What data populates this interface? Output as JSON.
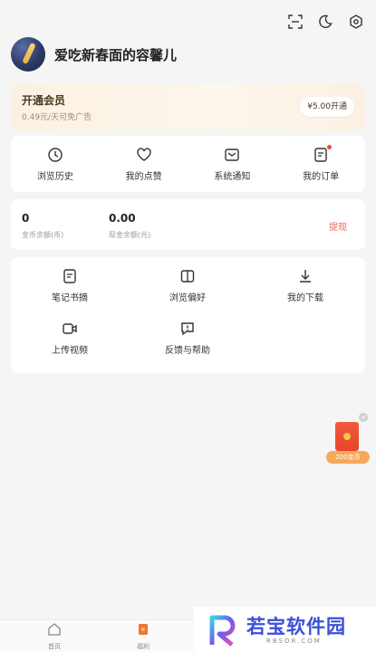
{
  "profile": {
    "username": "爱吃新春面的容馨儿"
  },
  "vip": {
    "title": "开通会员",
    "subtitle": "0.49元/天可免广告",
    "button": "¥5.00开通"
  },
  "quick_row": [
    {
      "label": "浏览历史",
      "icon": "clock-icon"
    },
    {
      "label": "我的点赞",
      "icon": "heart-icon"
    },
    {
      "label": "系统通知",
      "icon": "mail-icon"
    },
    {
      "label": "我的订单",
      "icon": "order-icon"
    }
  ],
  "wallet": {
    "coin_value": "0",
    "coin_label": "金币余额(币)",
    "cash_value": "0.00",
    "cash_label": "现金余额(元)",
    "withdraw": "提现"
  },
  "tools": [
    {
      "label": "笔记书摘",
      "icon": "note-icon"
    },
    {
      "label": "浏览偏好",
      "icon": "book-icon"
    },
    {
      "label": "我的下载",
      "icon": "download-icon"
    },
    {
      "label": "上传视频",
      "icon": "video-icon"
    },
    {
      "label": "反馈与帮助",
      "icon": "feedback-icon"
    }
  ],
  "float_packet": {
    "tag": "200金币"
  },
  "tabbar": [
    {
      "label": "首页",
      "icon": "home-icon"
    },
    {
      "label": "福利",
      "icon": "gift-icon"
    }
  ],
  "watermark": {
    "title": "若宝软件园",
    "sub": "RBSOR.COM"
  },
  "colors": {
    "accent": "#e96b52",
    "badge": "#f04a3a",
    "vip_bg": "#fbf1e3",
    "watermark": "#3b4fd9"
  }
}
